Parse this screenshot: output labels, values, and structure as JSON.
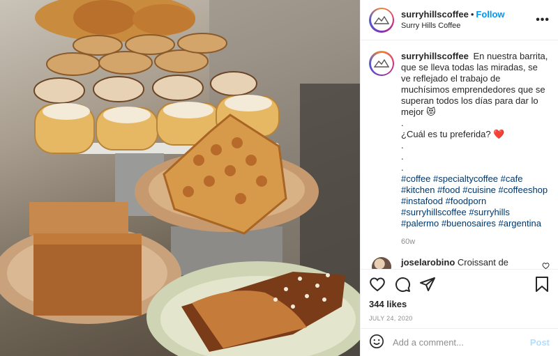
{
  "header": {
    "username": "surryhillscoffee",
    "separator": "•",
    "follow_label": "Follow",
    "location": "Surry Hills Coffee",
    "more_icon": "more-horizontal-icon"
  },
  "caption": {
    "username": "surryhillscoffee",
    "text_line1": "En nuestra barrita, que se lleva todas las miradas, se ve reflejado el trabajo de muchísimos emprendedores que se superan todos los días para dar lo mejor 😻",
    "dot1": ".",
    "question": "¿Cuál es tu preferida? ❤️",
    "dot2": ".",
    "dot3": ".",
    "dot4": ".",
    "hashtags": [
      "#coffee",
      "#specialtycoffee",
      "#cafe",
      "#kitchen",
      "#food",
      "#cuisine",
      "#coffeeshop",
      "#instafood",
      "#foodporn",
      "#surryhillscoffee",
      "#surryhills",
      "#palermo",
      "#buenosaires",
      "#argentina"
    ],
    "age": "60w"
  },
  "comment": {
    "username": "joselarobino",
    "text": "Croissant de almendras, siempre ♥️"
  },
  "actions": {
    "likes": "344 likes",
    "date": "JULY 24, 2020"
  },
  "add_comment": {
    "placeholder": "Add a comment...",
    "post_label": "Post"
  },
  "colors": {
    "link_blue": "#0095f6",
    "hashtag": "#00376b",
    "post_disabled": "#b2dffc",
    "meta_gray": "#8e8e8e"
  }
}
